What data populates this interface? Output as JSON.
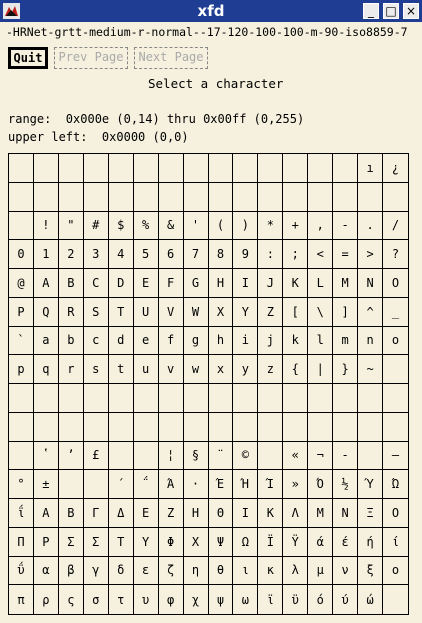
{
  "window": {
    "title": "xfd",
    "font_name": "-HRNet-grtt-medium-r-normal--17-120-100-100-m-90-iso8859-7",
    "title_buttons": [
      "_",
      "□",
      "×"
    ]
  },
  "toolbar": {
    "quit_label": "Quit",
    "prev_label": "Prev Page",
    "next_label": "Next Page"
  },
  "select_label": "Select a character",
  "info": {
    "range": "range:  0x000e (0,14) thru 0x00ff (0,255)",
    "upper_left": "upper left:  0x0000 (0,0)"
  },
  "colors": {
    "titlebar": "#1f3d92",
    "background": "#f5f1de"
  },
  "grid_rows": [
    [
      "",
      "",
      "",
      "",
      "",
      "",
      "",
      "",
      "",
      "",
      "",
      "",
      "",
      "",
      "ı",
      "¿"
    ],
    [
      "",
      "",
      "",
      "",
      "",
      "",
      "",
      "",
      "",
      "",
      "",
      "",
      "",
      "",
      "",
      ""
    ],
    [
      "",
      "!",
      "\"",
      "#",
      "$",
      "%",
      "&",
      "'",
      "(",
      ")",
      "*",
      "+",
      ",",
      "-",
      ".",
      "/"
    ],
    [
      "0",
      "1",
      "2",
      "3",
      "4",
      "5",
      "6",
      "7",
      "8",
      "9",
      ":",
      ";",
      "<",
      "=",
      ">",
      "?"
    ],
    [
      "@",
      "A",
      "B",
      "C",
      "D",
      "E",
      "F",
      "G",
      "H",
      "I",
      "J",
      "K",
      "L",
      "M",
      "N",
      "O"
    ],
    [
      "P",
      "Q",
      "R",
      "S",
      "T",
      "U",
      "V",
      "W",
      "X",
      "Y",
      "Z",
      "[",
      "\\",
      "]",
      "^",
      "_"
    ],
    [
      "`",
      "a",
      "b",
      "c",
      "d",
      "e",
      "f",
      "g",
      "h",
      "i",
      "j",
      "k",
      "l",
      "m",
      "n",
      "o"
    ],
    [
      "p",
      "q",
      "r",
      "s",
      "t",
      "u",
      "v",
      "w",
      "x",
      "y",
      "z",
      "{",
      "|",
      "}",
      "~",
      ""
    ],
    [
      "",
      "",
      "",
      "",
      "",
      "",
      "",
      "",
      "",
      "",
      "",
      "",
      "",
      "",
      "",
      ""
    ],
    [
      "",
      "",
      "",
      "",
      "",
      "",
      "",
      "",
      "",
      "",
      "",
      "",
      "",
      "",
      "",
      ""
    ],
    [
      "",
      "ʽ",
      "ʼ",
      "£",
      "",
      "",
      "¦",
      "§",
      "¨",
      "©",
      "",
      "«",
      "¬",
      "-",
      "",
      "―"
    ],
    [
      "°",
      "±",
      "",
      "",
      "΄",
      "΅",
      "Ά",
      "·",
      "Έ",
      "Ή",
      "Ί",
      "»",
      "Ό",
      "½",
      "Ύ",
      "Ώ"
    ],
    [
      "ΐ",
      "Α",
      "Β",
      "Γ",
      "Δ",
      "Ε",
      "Ζ",
      "Η",
      "Θ",
      "Ι",
      "Κ",
      "Λ",
      "Μ",
      "Ν",
      "Ξ",
      "Ο"
    ],
    [
      "Π",
      "Ρ",
      "Σ",
      "Σ",
      "Τ",
      "Υ",
      "Φ",
      "Χ",
      "Ψ",
      "Ω",
      "Ϊ",
      "Ϋ",
      "ά",
      "έ",
      "ή",
      "ί"
    ],
    [
      "ΰ",
      "α",
      "β",
      "γ",
      "δ",
      "ε",
      "ζ",
      "η",
      "θ",
      "ι",
      "κ",
      "λ",
      "μ",
      "ν",
      "ξ",
      "ο"
    ],
    [
      "π",
      "ρ",
      "ς",
      "σ",
      "τ",
      "υ",
      "φ",
      "χ",
      "ψ",
      "ω",
      "ϊ",
      "ϋ",
      "ό",
      "ύ",
      "ώ",
      ""
    ]
  ]
}
